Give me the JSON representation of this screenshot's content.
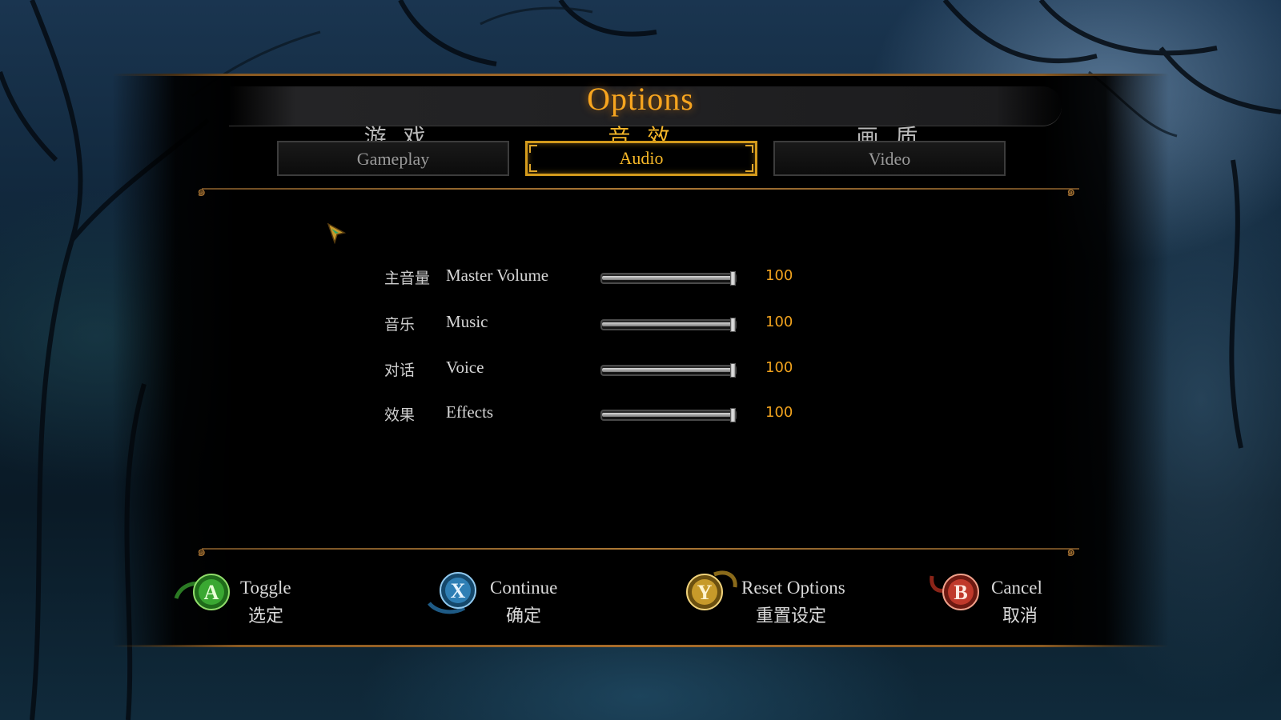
{
  "title": "Options",
  "tabs": [
    {
      "zh": "游 戏",
      "en": "Gameplay",
      "active": false
    },
    {
      "zh": "音 效",
      "en": "Audio",
      "active": true
    },
    {
      "zh": "画 质",
      "en": "Video",
      "active": false
    }
  ],
  "settings": [
    {
      "zh": "主音量",
      "en": "Master Volume",
      "value": "100",
      "level": 1.0
    },
    {
      "zh": "音乐",
      "en": "Music",
      "value": "100",
      "level": 1.0
    },
    {
      "zh": "对话",
      "en": "Voice",
      "value": "100",
      "level": 1.0
    },
    {
      "zh": "效果",
      "en": "Effects",
      "value": "100",
      "level": 1.0
    }
  ],
  "footer": [
    {
      "key": "A",
      "en": "Toggle",
      "zh": "选定",
      "color": "#3aa832"
    },
    {
      "key": "X",
      "en": "Continue",
      "zh": "确定",
      "color": "#2f7fb5"
    },
    {
      "key": "Y",
      "en": "Reset Options",
      "zh": "重置设定",
      "color": "#c79a2a"
    },
    {
      "key": "B",
      "en": "Cancel",
      "zh": "取消",
      "color": "#c0392b"
    }
  ],
  "colors": {
    "accent": "#f7a51f",
    "value": "#f0a21e",
    "frame": "#a86c2a"
  }
}
